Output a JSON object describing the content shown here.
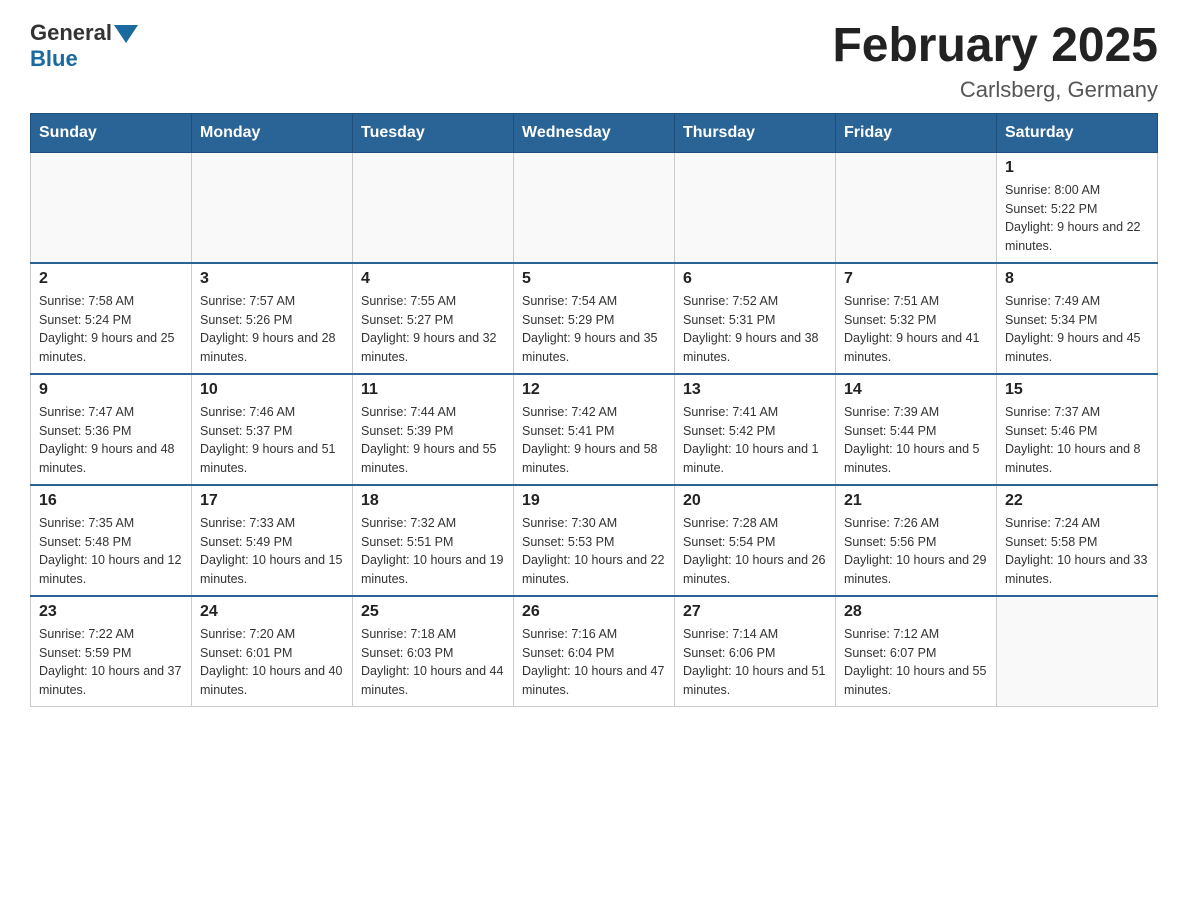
{
  "header": {
    "logo_text": "General",
    "logo_blue": "Blue",
    "title": "February 2025",
    "subtitle": "Carlsberg, Germany"
  },
  "weekdays": [
    "Sunday",
    "Monday",
    "Tuesday",
    "Wednesday",
    "Thursday",
    "Friday",
    "Saturday"
  ],
  "weeks": [
    [
      {
        "day": "",
        "info": ""
      },
      {
        "day": "",
        "info": ""
      },
      {
        "day": "",
        "info": ""
      },
      {
        "day": "",
        "info": ""
      },
      {
        "day": "",
        "info": ""
      },
      {
        "day": "",
        "info": ""
      },
      {
        "day": "1",
        "info": "Sunrise: 8:00 AM\nSunset: 5:22 PM\nDaylight: 9 hours and 22 minutes."
      }
    ],
    [
      {
        "day": "2",
        "info": "Sunrise: 7:58 AM\nSunset: 5:24 PM\nDaylight: 9 hours and 25 minutes."
      },
      {
        "day": "3",
        "info": "Sunrise: 7:57 AM\nSunset: 5:26 PM\nDaylight: 9 hours and 28 minutes."
      },
      {
        "day": "4",
        "info": "Sunrise: 7:55 AM\nSunset: 5:27 PM\nDaylight: 9 hours and 32 minutes."
      },
      {
        "day": "5",
        "info": "Sunrise: 7:54 AM\nSunset: 5:29 PM\nDaylight: 9 hours and 35 minutes."
      },
      {
        "day": "6",
        "info": "Sunrise: 7:52 AM\nSunset: 5:31 PM\nDaylight: 9 hours and 38 minutes."
      },
      {
        "day": "7",
        "info": "Sunrise: 7:51 AM\nSunset: 5:32 PM\nDaylight: 9 hours and 41 minutes."
      },
      {
        "day": "8",
        "info": "Sunrise: 7:49 AM\nSunset: 5:34 PM\nDaylight: 9 hours and 45 minutes."
      }
    ],
    [
      {
        "day": "9",
        "info": "Sunrise: 7:47 AM\nSunset: 5:36 PM\nDaylight: 9 hours and 48 minutes."
      },
      {
        "day": "10",
        "info": "Sunrise: 7:46 AM\nSunset: 5:37 PM\nDaylight: 9 hours and 51 minutes."
      },
      {
        "day": "11",
        "info": "Sunrise: 7:44 AM\nSunset: 5:39 PM\nDaylight: 9 hours and 55 minutes."
      },
      {
        "day": "12",
        "info": "Sunrise: 7:42 AM\nSunset: 5:41 PM\nDaylight: 9 hours and 58 minutes."
      },
      {
        "day": "13",
        "info": "Sunrise: 7:41 AM\nSunset: 5:42 PM\nDaylight: 10 hours and 1 minute."
      },
      {
        "day": "14",
        "info": "Sunrise: 7:39 AM\nSunset: 5:44 PM\nDaylight: 10 hours and 5 minutes."
      },
      {
        "day": "15",
        "info": "Sunrise: 7:37 AM\nSunset: 5:46 PM\nDaylight: 10 hours and 8 minutes."
      }
    ],
    [
      {
        "day": "16",
        "info": "Sunrise: 7:35 AM\nSunset: 5:48 PM\nDaylight: 10 hours and 12 minutes."
      },
      {
        "day": "17",
        "info": "Sunrise: 7:33 AM\nSunset: 5:49 PM\nDaylight: 10 hours and 15 minutes."
      },
      {
        "day": "18",
        "info": "Sunrise: 7:32 AM\nSunset: 5:51 PM\nDaylight: 10 hours and 19 minutes."
      },
      {
        "day": "19",
        "info": "Sunrise: 7:30 AM\nSunset: 5:53 PM\nDaylight: 10 hours and 22 minutes."
      },
      {
        "day": "20",
        "info": "Sunrise: 7:28 AM\nSunset: 5:54 PM\nDaylight: 10 hours and 26 minutes."
      },
      {
        "day": "21",
        "info": "Sunrise: 7:26 AM\nSunset: 5:56 PM\nDaylight: 10 hours and 29 minutes."
      },
      {
        "day": "22",
        "info": "Sunrise: 7:24 AM\nSunset: 5:58 PM\nDaylight: 10 hours and 33 minutes."
      }
    ],
    [
      {
        "day": "23",
        "info": "Sunrise: 7:22 AM\nSunset: 5:59 PM\nDaylight: 10 hours and 37 minutes."
      },
      {
        "day": "24",
        "info": "Sunrise: 7:20 AM\nSunset: 6:01 PM\nDaylight: 10 hours and 40 minutes."
      },
      {
        "day": "25",
        "info": "Sunrise: 7:18 AM\nSunset: 6:03 PM\nDaylight: 10 hours and 44 minutes."
      },
      {
        "day": "26",
        "info": "Sunrise: 7:16 AM\nSunset: 6:04 PM\nDaylight: 10 hours and 47 minutes."
      },
      {
        "day": "27",
        "info": "Sunrise: 7:14 AM\nSunset: 6:06 PM\nDaylight: 10 hours and 51 minutes."
      },
      {
        "day": "28",
        "info": "Sunrise: 7:12 AM\nSunset: 6:07 PM\nDaylight: 10 hours and 55 minutes."
      },
      {
        "day": "",
        "info": ""
      }
    ]
  ]
}
